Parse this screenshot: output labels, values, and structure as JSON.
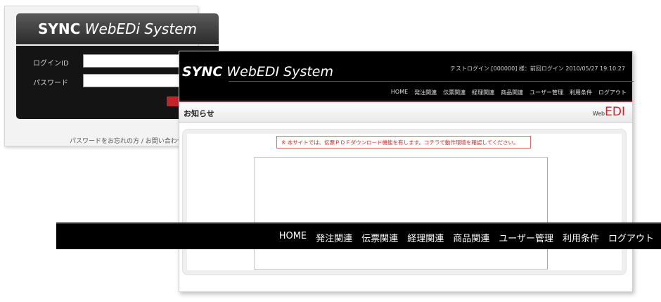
{
  "login": {
    "title_bold": "SYNC",
    "title_rest": "WebEDi System",
    "id_label": "ログインID",
    "password_label": "パスワード",
    "footer": "パスワードをお忘れの方 / お問い合わせ"
  },
  "main": {
    "brand_bold": "SYNC",
    "brand_rest": "WebEDI System",
    "login_info": "テストログイン [000000] 様：前回ログイン 2010/05/27 19:10:27",
    "nav": [
      "HOME",
      "発注関連",
      "伝票関連",
      "経理関連",
      "商品関連",
      "ユーザー管理",
      "利用条件",
      "ログアウト"
    ],
    "page_title": "お知らせ",
    "logo_web": "Web",
    "logo_edi": "EDI",
    "pdf_notice": "※ 本サイトでは、伝票ＰＤＦダウンロード機能を有します。コチラで動作環境を確認してください。"
  },
  "colors": {
    "accent_red": "#cc2027",
    "header_bg": "#000000"
  }
}
